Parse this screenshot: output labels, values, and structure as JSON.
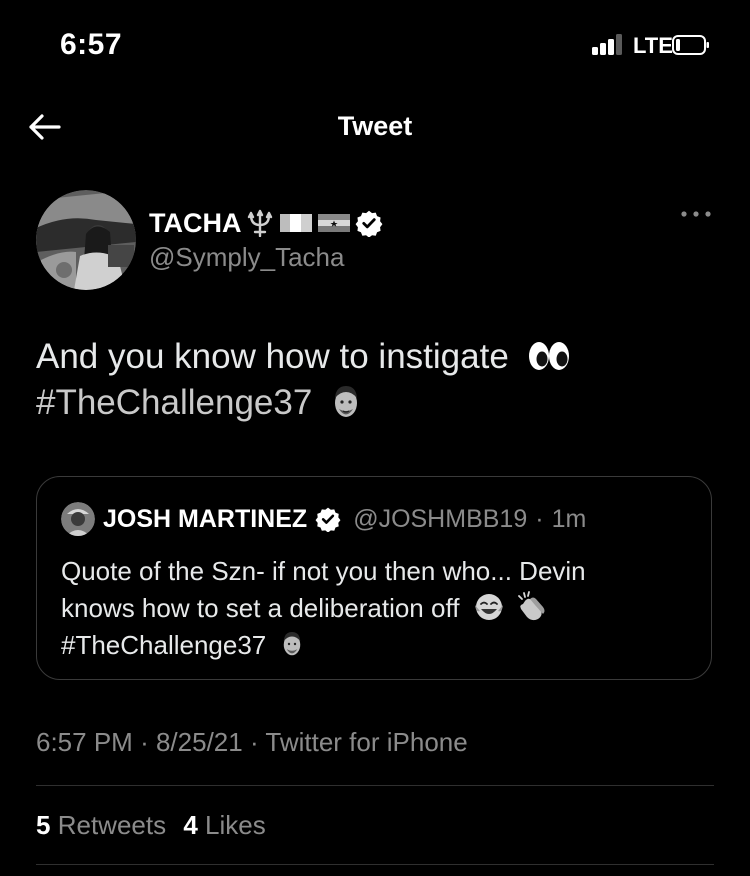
{
  "status_bar": {
    "time": "6:57",
    "network": "LTE"
  },
  "nav": {
    "back_icon": "back-arrow-icon",
    "title": "Tweet"
  },
  "author": {
    "name": "TACHA",
    "handle": "@Symply_Tacha",
    "name_emoji": [
      "trident",
      "ireland-flag",
      "ghana-flag"
    ],
    "verified": true,
    "more_icon": "more-horizontal-icon"
  },
  "tweet": {
    "text": "And you know how to instigate",
    "text_emoji": "eyes",
    "hashtag": "#TheChallenge37",
    "hashtag_emoji": "man-face"
  },
  "quote": {
    "name": "JOSH MARTINEZ",
    "handle": "@JOSHMBB19",
    "separator": "·",
    "time": "1m",
    "verified": true,
    "line1": "Quote of the Szn- if not you then who... Devin",
    "line2": "knows how to set a deliberation off",
    "line2_emoji": [
      "face-with-tears-of-joy",
      "clapping-hands"
    ],
    "hashtag": "#TheChallenge37",
    "hashtag_emoji": "man-face"
  },
  "meta": {
    "time": "6:57 PM",
    "date": "8/25/21",
    "source": "Twitter for iPhone",
    "separator": "·"
  },
  "stats": {
    "retweets_count": "5",
    "retweets_label": "Retweets",
    "likes_count": "4",
    "likes_label": "Likes"
  },
  "colors": {
    "background": "#000000",
    "text": "#e7e9ea",
    "secondary": "#8b8b8b",
    "divider": "#2f2f2f"
  }
}
